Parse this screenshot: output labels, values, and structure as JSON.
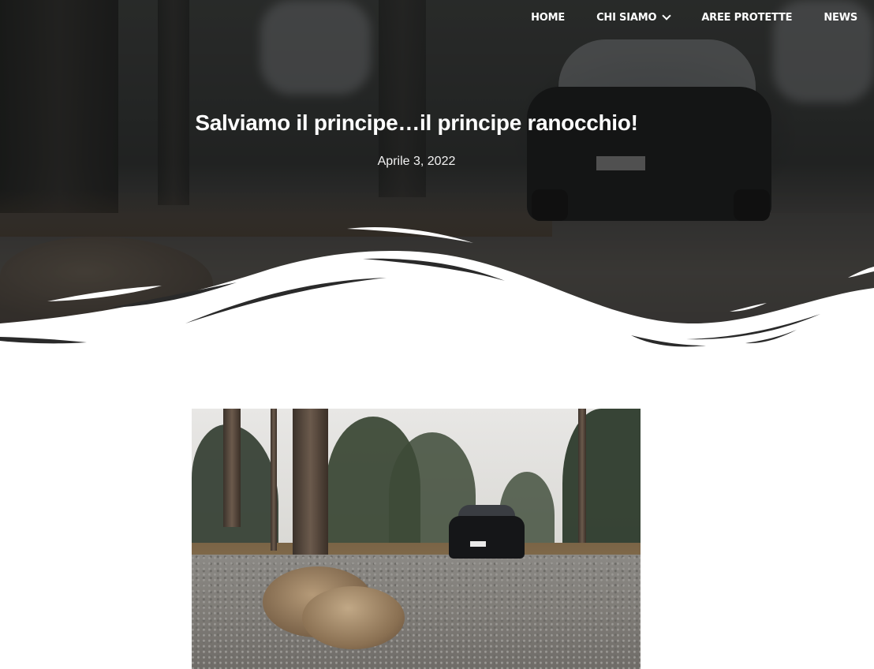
{
  "nav": {
    "items": [
      {
        "label": "HOME"
      },
      {
        "label": "CHI SIAMO",
        "has_dropdown": true
      },
      {
        "label": "AREE PROTETTE"
      },
      {
        "label": "NEWS"
      }
    ]
  },
  "post": {
    "title": "Salviamo il principe…il principe ranocchio!",
    "date": "Aprile 3, 2022"
  },
  "colors": {
    "nav_text": "#ffffff",
    "page_background": "#ffffff",
    "hero_overlay": "#1e1e1e"
  },
  "icons": {
    "dropdown": "chevron-down-icon"
  }
}
